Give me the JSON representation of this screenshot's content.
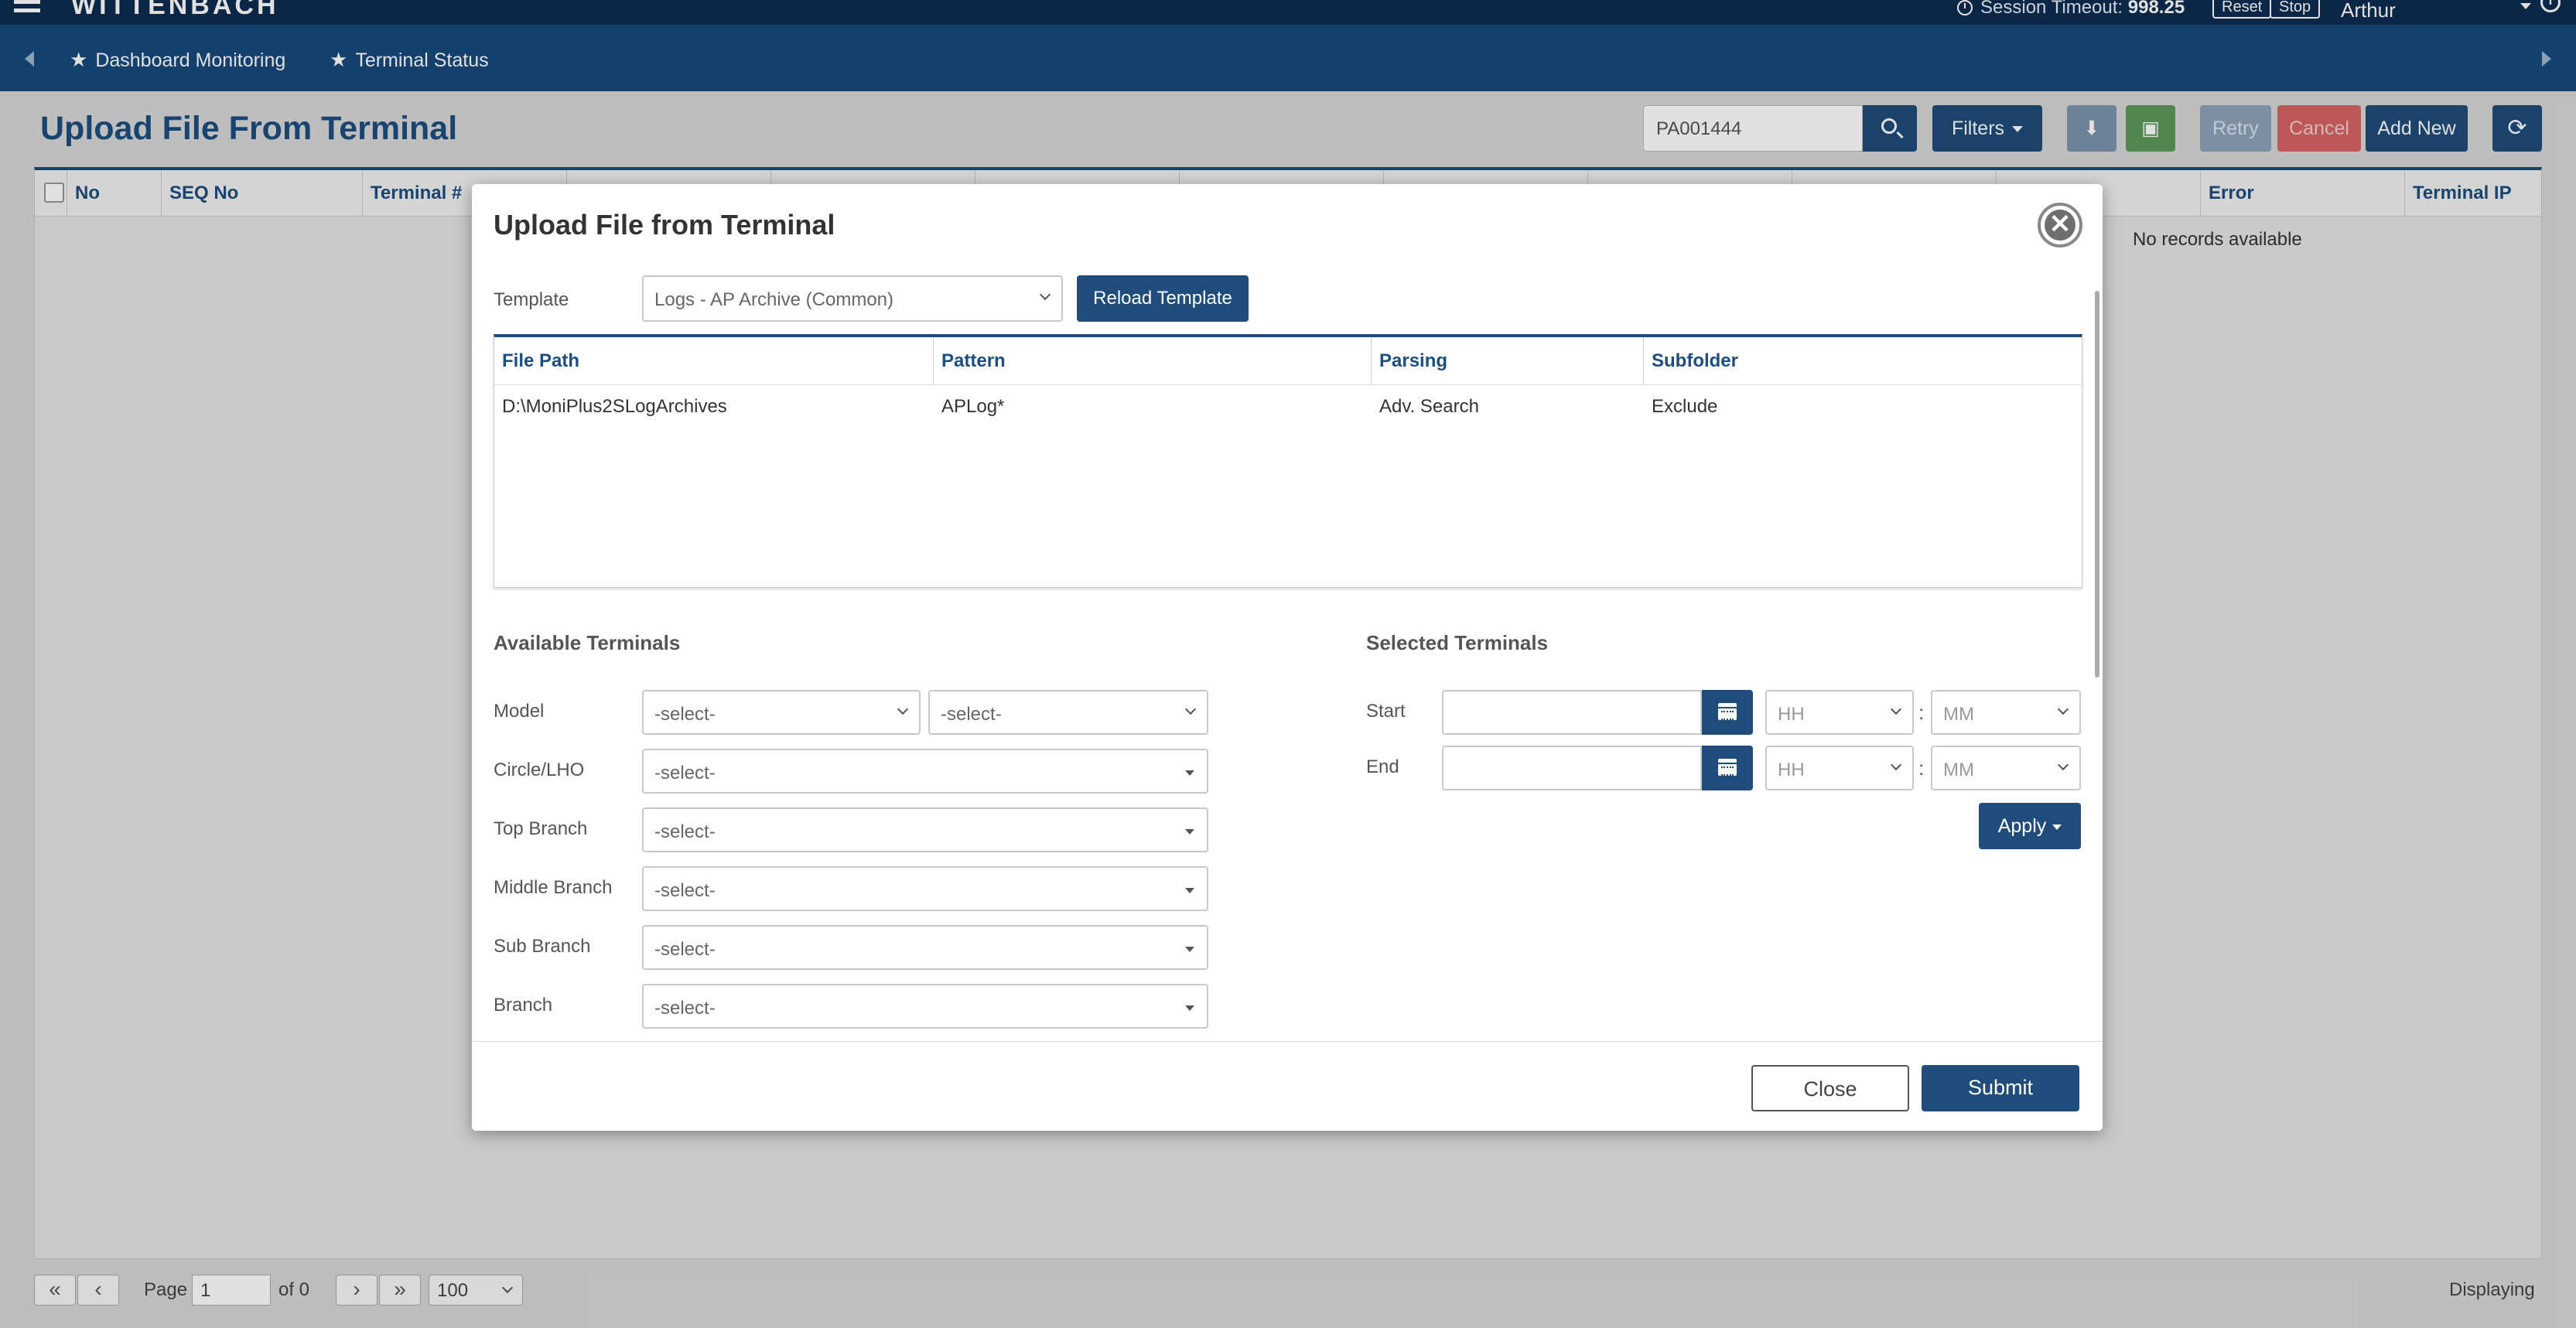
{
  "topbar": {
    "brand": "WITTENBACH",
    "session_label": "Session Timeout:",
    "session_value": "998.25",
    "reset_label": "Reset",
    "stop_label": "Stop",
    "user_name": "Arthur"
  },
  "nav": {
    "items": [
      {
        "label": "Dashboard Monitoring"
      },
      {
        "label": "Terminal Status"
      }
    ]
  },
  "page": {
    "title": "Upload File From Terminal",
    "search_value": "PA001444",
    "filters_label": "Filters",
    "retry_label": "Retry",
    "cancel_label": "Cancel",
    "add_new_label": "Add New"
  },
  "table": {
    "columns": [
      "No",
      "SEQ No",
      "Terminal #",
      "Error",
      "Terminal IP"
    ],
    "empty_text": "No records available"
  },
  "pager": {
    "page_label": "Page",
    "page_value": "1",
    "of_label": "of 0",
    "page_size": "100",
    "displaying_label": "Displaying"
  },
  "modal": {
    "title": "Upload File from Terminal",
    "template_label": "Template",
    "template_value": "Logs - AP Archive (Common)",
    "reload_label": "Reload Template",
    "template_table": {
      "columns": [
        "File Path",
        "Pattern",
        "Parsing",
        "Subfolder"
      ],
      "rows": [
        [
          "D:\\MoniPlus2SLogArchives",
          "APLog*",
          "Adv. Search",
          "Exclude"
        ]
      ]
    },
    "available_title": "Available Terminals",
    "selected_title": "Selected Terminals",
    "filters": {
      "model_label": "Model",
      "model_value_1": "-select-",
      "model_value_2": "-select-",
      "circle_label": "Circle/LHO",
      "circle_value": "-select-",
      "top_branch_label": "Top Branch",
      "top_branch_value": "-select-",
      "middle_branch_label": "Middle Branch",
      "middle_branch_value": "-select-",
      "sub_branch_label": "Sub Branch",
      "sub_branch_value": "-select-",
      "branch_label": "Branch",
      "branch_value": "-select-"
    },
    "time": {
      "start_label": "Start",
      "end_label": "End",
      "hh_placeholder": "HH",
      "mm_placeholder": "MM",
      "separator": ":",
      "apply_label": "Apply"
    },
    "close_label": "Close",
    "submit_label": "Submit"
  },
  "colors": {
    "topbar": "#0e2d50",
    "navbar": "#17497d",
    "primary": "#1f4c7a",
    "excel": "#5d9a5a",
    "cancel": "#d96565"
  }
}
